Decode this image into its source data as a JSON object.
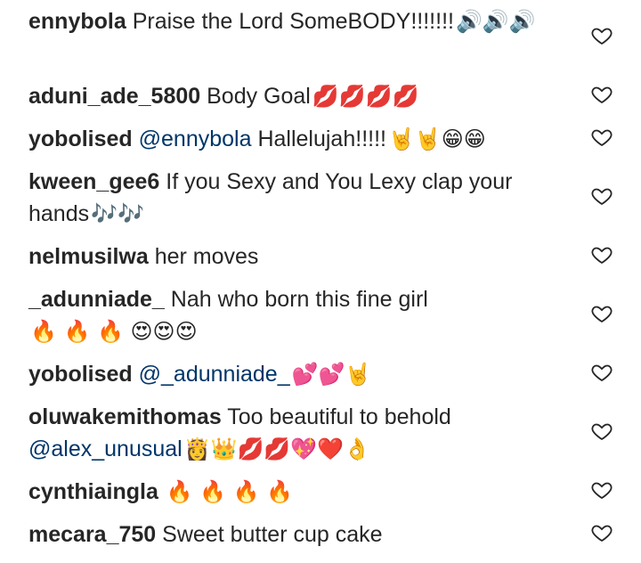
{
  "comments": [
    {
      "user": "ennybola",
      "text": "Praise the Lord SomeBODY!!!!!!!",
      "emojis": "🔊🔊🔊"
    },
    {
      "user": "aduni_ade_5800",
      "text": "Body Goal",
      "emojis": "💋💋💋💋"
    },
    {
      "user": "yobolised",
      "mention": "@ennybola",
      "text": "Hallelujah!!!!!",
      "emojis": "🤘🤘😁😁"
    },
    {
      "user": "kween_gee6",
      "text": "If you Sexy and You Lexy clap your hands",
      "emojis": "🎶🎶"
    },
    {
      "user": "nelmusilwa",
      "text": "her moves",
      "emojis": ""
    },
    {
      "user": "_adunniade_",
      "text": "Nah who born this fine girl",
      "emojis": "🔥 🔥 🔥 😍😍😍"
    },
    {
      "user": "yobolised",
      "mention": "@_adunniade_",
      "text": "",
      "emojis": "💕💕🤘"
    },
    {
      "user": "oluwakemithomas",
      "text": "Too beautiful to behold",
      "mention": "@alex_unusual",
      "emojis": "👸👑💋💋💖❤️👌"
    },
    {
      "user": "cynthiaingla",
      "text": "",
      "emojis": "🔥 🔥 🔥 🔥"
    },
    {
      "user": "mecara_750",
      "text": "Sweet butter cup cake",
      "emojis": ""
    }
  ],
  "icons": {
    "like": "heart-outline-icon"
  },
  "colors": {
    "text": "#262626",
    "mention": "#003569",
    "icon": "#262626"
  }
}
